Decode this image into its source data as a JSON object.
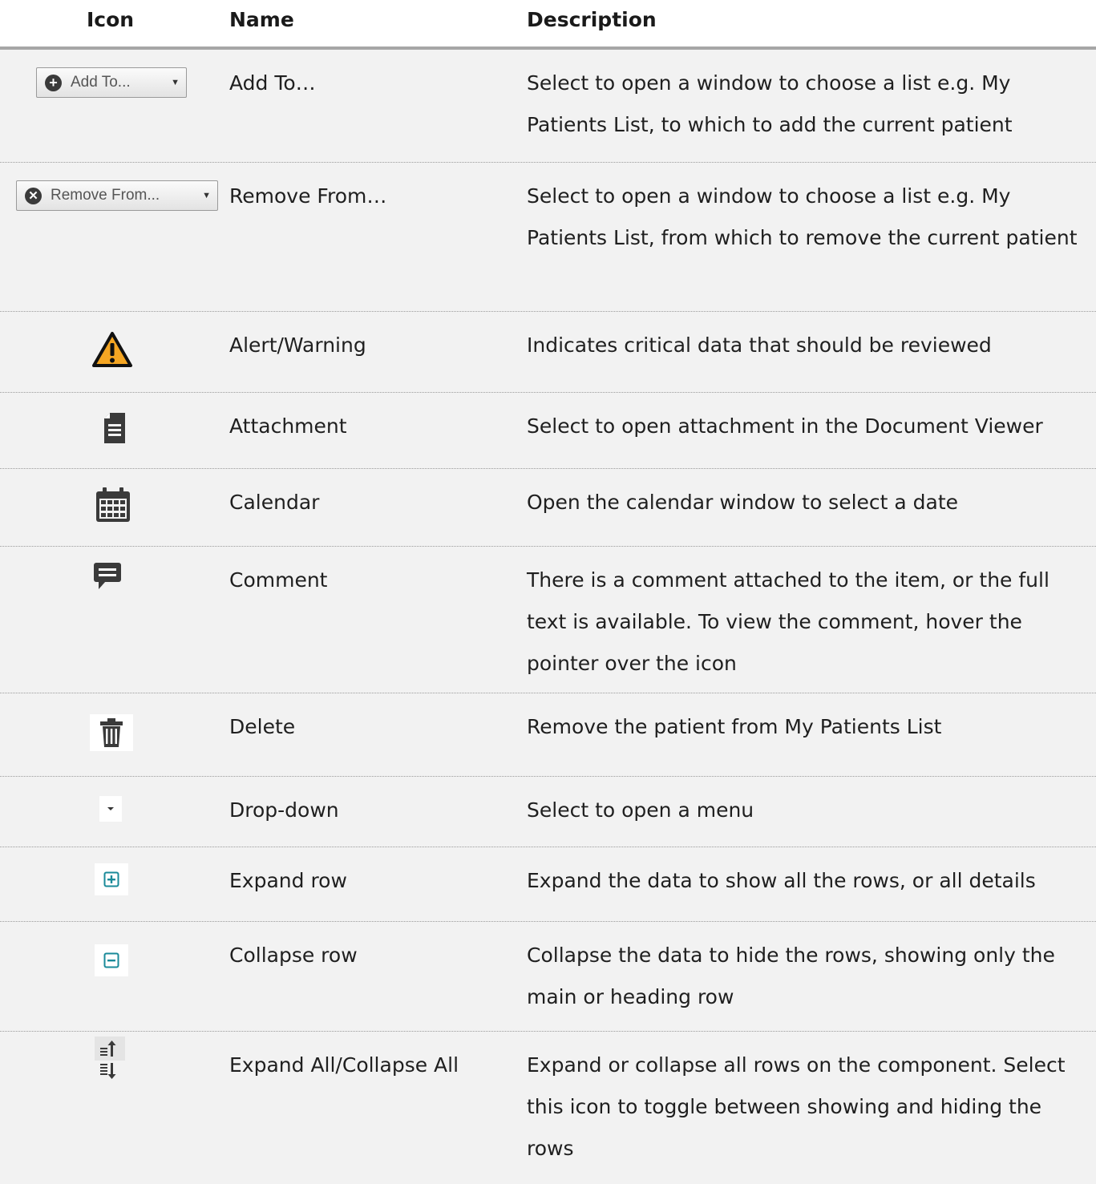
{
  "header": {
    "icon": "Icon",
    "name": "Name",
    "description": "Description"
  },
  "rows": [
    {
      "icon": "add-to-button-icon",
      "button_label": "Add To...",
      "name": "Add To…",
      "description": "Select to open a window to choose a list e.g. My Patients List, to which to add the current patient"
    },
    {
      "icon": "remove-from-button-icon",
      "button_label": "Remove From...",
      "name": "Remove From…",
      "description": "Select to open a window to choose a list e.g. My Patients List, from which to remove the current patient"
    },
    {
      "icon": "warning-icon",
      "name": "Alert/Warning",
      "description": "Indicates critical data that should be reviewed"
    },
    {
      "icon": "document-icon",
      "name": "Attachment",
      "description": "Select to open attachment in the Document Viewer"
    },
    {
      "icon": "calendar-icon",
      "name": "Calendar",
      "description": "Open the calendar window to select a date"
    },
    {
      "icon": "comment-icon",
      "name": "Comment",
      "description": "There is a comment attached to the item, or the full text is available. To view the comment, hover the pointer over the icon"
    },
    {
      "icon": "trash-icon",
      "name": "Delete",
      "description": "Remove the patient from My Patients List"
    },
    {
      "icon": "dropdown-icon",
      "name": "Drop-down",
      "description": "Select to open a menu"
    },
    {
      "icon": "plus-box-icon",
      "name": "Expand row",
      "description": "Expand the data to show all the rows, or all details"
    },
    {
      "icon": "minus-box-icon",
      "name": "Collapse row",
      "description": "Collapse the data to hide the rows, showing only the main or heading row"
    },
    {
      "icon": "expand-collapse-all-icon",
      "name": "Expand All/Collapse All",
      "description": "Expand or collapse all rows on the component. Select this icon to toggle between showing and hiding the rows"
    }
  ],
  "colors": {
    "row_bg": "#f2f2f2",
    "warning_orange": "#f5a623",
    "teal_icon": "#1a8a99",
    "dark_icon": "#3a3a3a"
  }
}
